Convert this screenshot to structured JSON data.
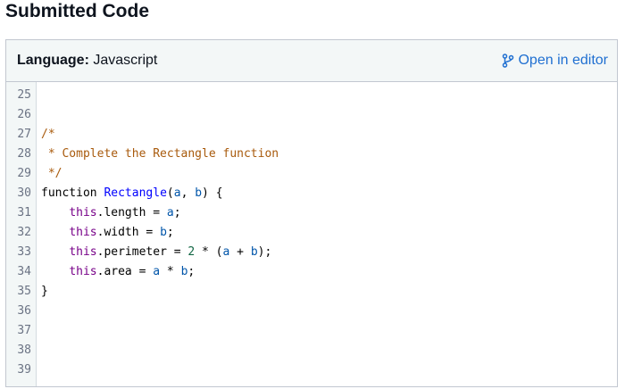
{
  "page": {
    "title": "Submitted Code"
  },
  "header": {
    "language_label": "Language:",
    "language_value": "Javascript",
    "open_editor_label": "Open in editor"
  },
  "colors": {
    "link": "#1f6fd1",
    "comment": "#a85a0c",
    "keyword": "#770088",
    "def": "#0000ff",
    "variable": "#0055aa"
  },
  "code": {
    "line_numbers": [
      "25",
      "26",
      "27",
      "28",
      "29",
      "30",
      "31",
      "32",
      "33",
      "34",
      "35",
      "36",
      "37",
      "38",
      "39"
    ],
    "lines": [
      {
        "tokens": []
      },
      {
        "tokens": []
      },
      {
        "tokens": [
          {
            "t": "/*",
            "c": "comment"
          }
        ]
      },
      {
        "tokens": [
          {
            "t": " * Complete the Rectangle function",
            "c": "comment"
          }
        ]
      },
      {
        "tokens": [
          {
            "t": " */",
            "c": "comment"
          }
        ]
      },
      {
        "tokens": [
          {
            "t": "function ",
            "c": "plain"
          },
          {
            "t": "Rectangle",
            "c": "def"
          },
          {
            "t": "(",
            "c": "plain"
          },
          {
            "t": "a",
            "c": "var"
          },
          {
            "t": ", ",
            "c": "plain"
          },
          {
            "t": "b",
            "c": "var"
          },
          {
            "t": ") {",
            "c": "plain"
          }
        ]
      },
      {
        "tokens": [
          {
            "t": "    ",
            "c": "plain"
          },
          {
            "t": "this",
            "c": "keyword"
          },
          {
            "t": ".length = ",
            "c": "plain"
          },
          {
            "t": "a",
            "c": "var"
          },
          {
            "t": ";",
            "c": "plain"
          }
        ]
      },
      {
        "tokens": [
          {
            "t": "    ",
            "c": "plain"
          },
          {
            "t": "this",
            "c": "keyword"
          },
          {
            "t": ".width = ",
            "c": "plain"
          },
          {
            "t": "b",
            "c": "var"
          },
          {
            "t": ";",
            "c": "plain"
          }
        ]
      },
      {
        "tokens": [
          {
            "t": "    ",
            "c": "plain"
          },
          {
            "t": "this",
            "c": "keyword"
          },
          {
            "t": ".perimeter = ",
            "c": "plain"
          },
          {
            "t": "2",
            "c": "number"
          },
          {
            "t": " * (",
            "c": "plain"
          },
          {
            "t": "a",
            "c": "var"
          },
          {
            "t": " + ",
            "c": "plain"
          },
          {
            "t": "b",
            "c": "var"
          },
          {
            "t": ");",
            "c": "plain"
          }
        ]
      },
      {
        "tokens": [
          {
            "t": "    ",
            "c": "plain"
          },
          {
            "t": "this",
            "c": "keyword"
          },
          {
            "t": ".area = ",
            "c": "plain"
          },
          {
            "t": "a",
            "c": "var"
          },
          {
            "t": " * ",
            "c": "plain"
          },
          {
            "t": "b",
            "c": "var"
          },
          {
            "t": ";",
            "c": "plain"
          }
        ]
      },
      {
        "tokens": [
          {
            "t": "}",
            "c": "plain"
          }
        ]
      },
      {
        "tokens": []
      },
      {
        "tokens": []
      },
      {
        "tokens": []
      },
      {
        "tokens": []
      }
    ]
  }
}
